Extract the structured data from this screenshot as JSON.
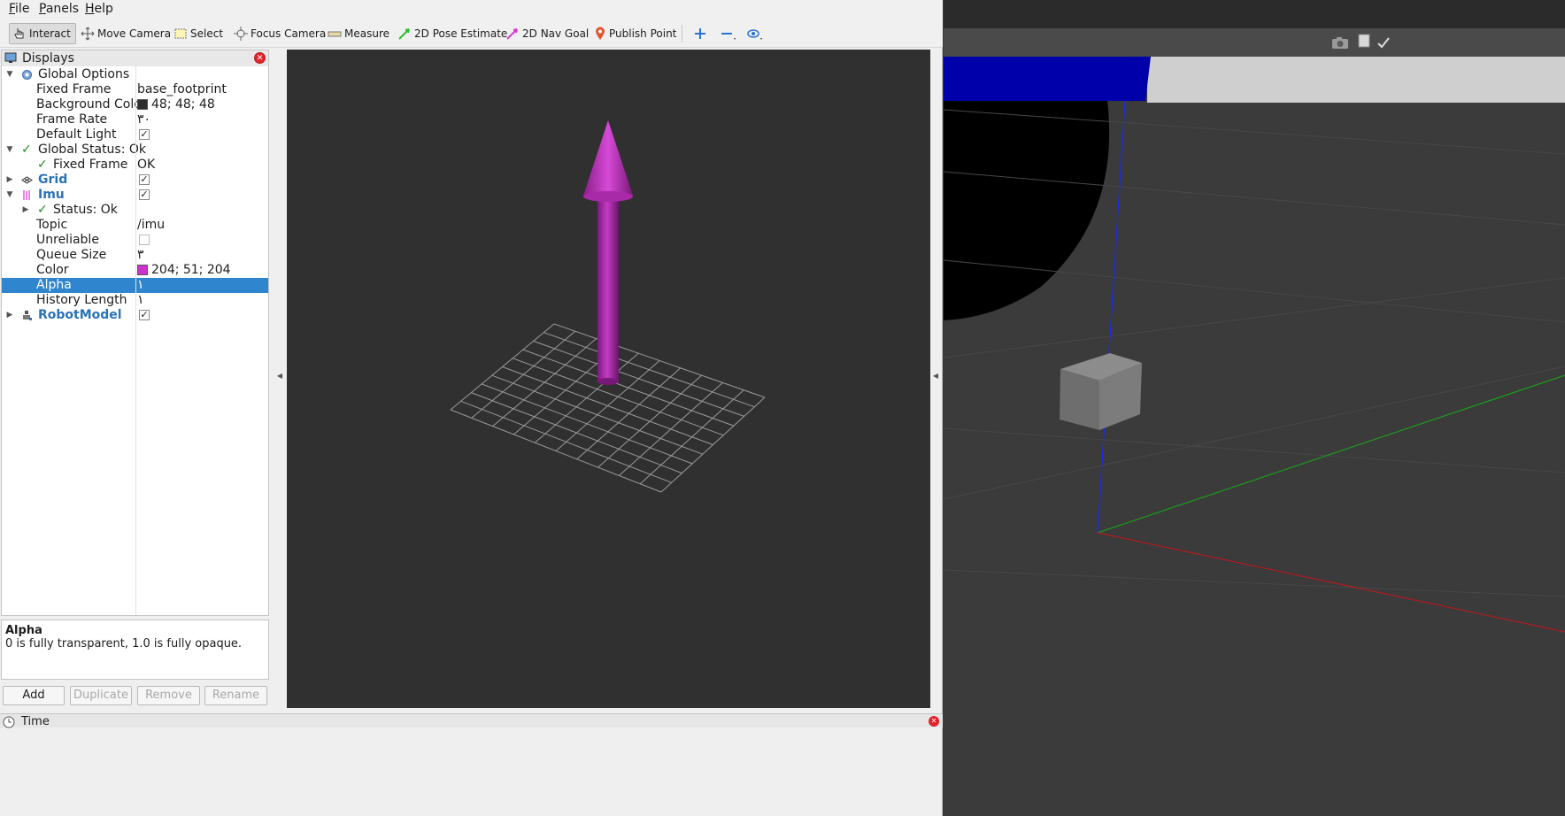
{
  "menubar": {
    "items": [
      {
        "label": "File",
        "mnemonic": "F",
        "rest": "ile"
      },
      {
        "label": "Panels",
        "mnemonic": "P",
        "rest": "anels"
      },
      {
        "label": "Help",
        "mnemonic": "H",
        "rest": "elp"
      }
    ]
  },
  "toolbar": {
    "interact": "Interact",
    "move_camera": "Move Camera",
    "select": "Select",
    "focus_camera": "Focus Camera",
    "measure": "Measure",
    "pose_estimate": "2D Pose Estimate",
    "nav_goal": "2D Nav Goal",
    "publish_point": "Publish Point"
  },
  "displays": {
    "title": "Displays",
    "rows": {
      "global_options": "Global Options",
      "fixed_frame_key": "Fixed Frame",
      "fixed_frame_val": "base_footprint",
      "bg_color_key": "Background Color",
      "bg_color_val": "48; 48; 48",
      "frame_rate_key": "Frame Rate",
      "frame_rate_val": "٣٠",
      "default_light_key": "Default Light",
      "global_status": "Global Status: Ok",
      "status_fixed_frame_key": "Fixed Frame",
      "status_fixed_frame_val": "OK",
      "grid": "Grid",
      "imu": "Imu",
      "imu_status": "Status: Ok",
      "topic_key": "Topic",
      "topic_val": "/imu",
      "unreliable_key": "Unreliable",
      "queue_size_key": "Queue Size",
      "queue_size_val": "٣",
      "color_key": "Color",
      "color_val": "204; 51; 204",
      "alpha_key": "Alpha",
      "alpha_val": "١",
      "history_key": "History Length",
      "history_val": "١",
      "robot_model": "RobotModel"
    },
    "checks": {
      "default_light": true,
      "grid": true,
      "imu": true,
      "unreliable": false,
      "robot_model": true
    }
  },
  "description": {
    "title": "Alpha",
    "text": "0 is fully transparent, 1.0 is fully opaque."
  },
  "buttons": {
    "add": "Add",
    "duplicate": "Duplicate",
    "remove": "Remove",
    "rename": "Rename"
  },
  "time_panel": {
    "title": "Time"
  },
  "colors": {
    "background": "#303030",
    "imu_arrow": "#cc33cc",
    "selection": "#2f86cf"
  }
}
